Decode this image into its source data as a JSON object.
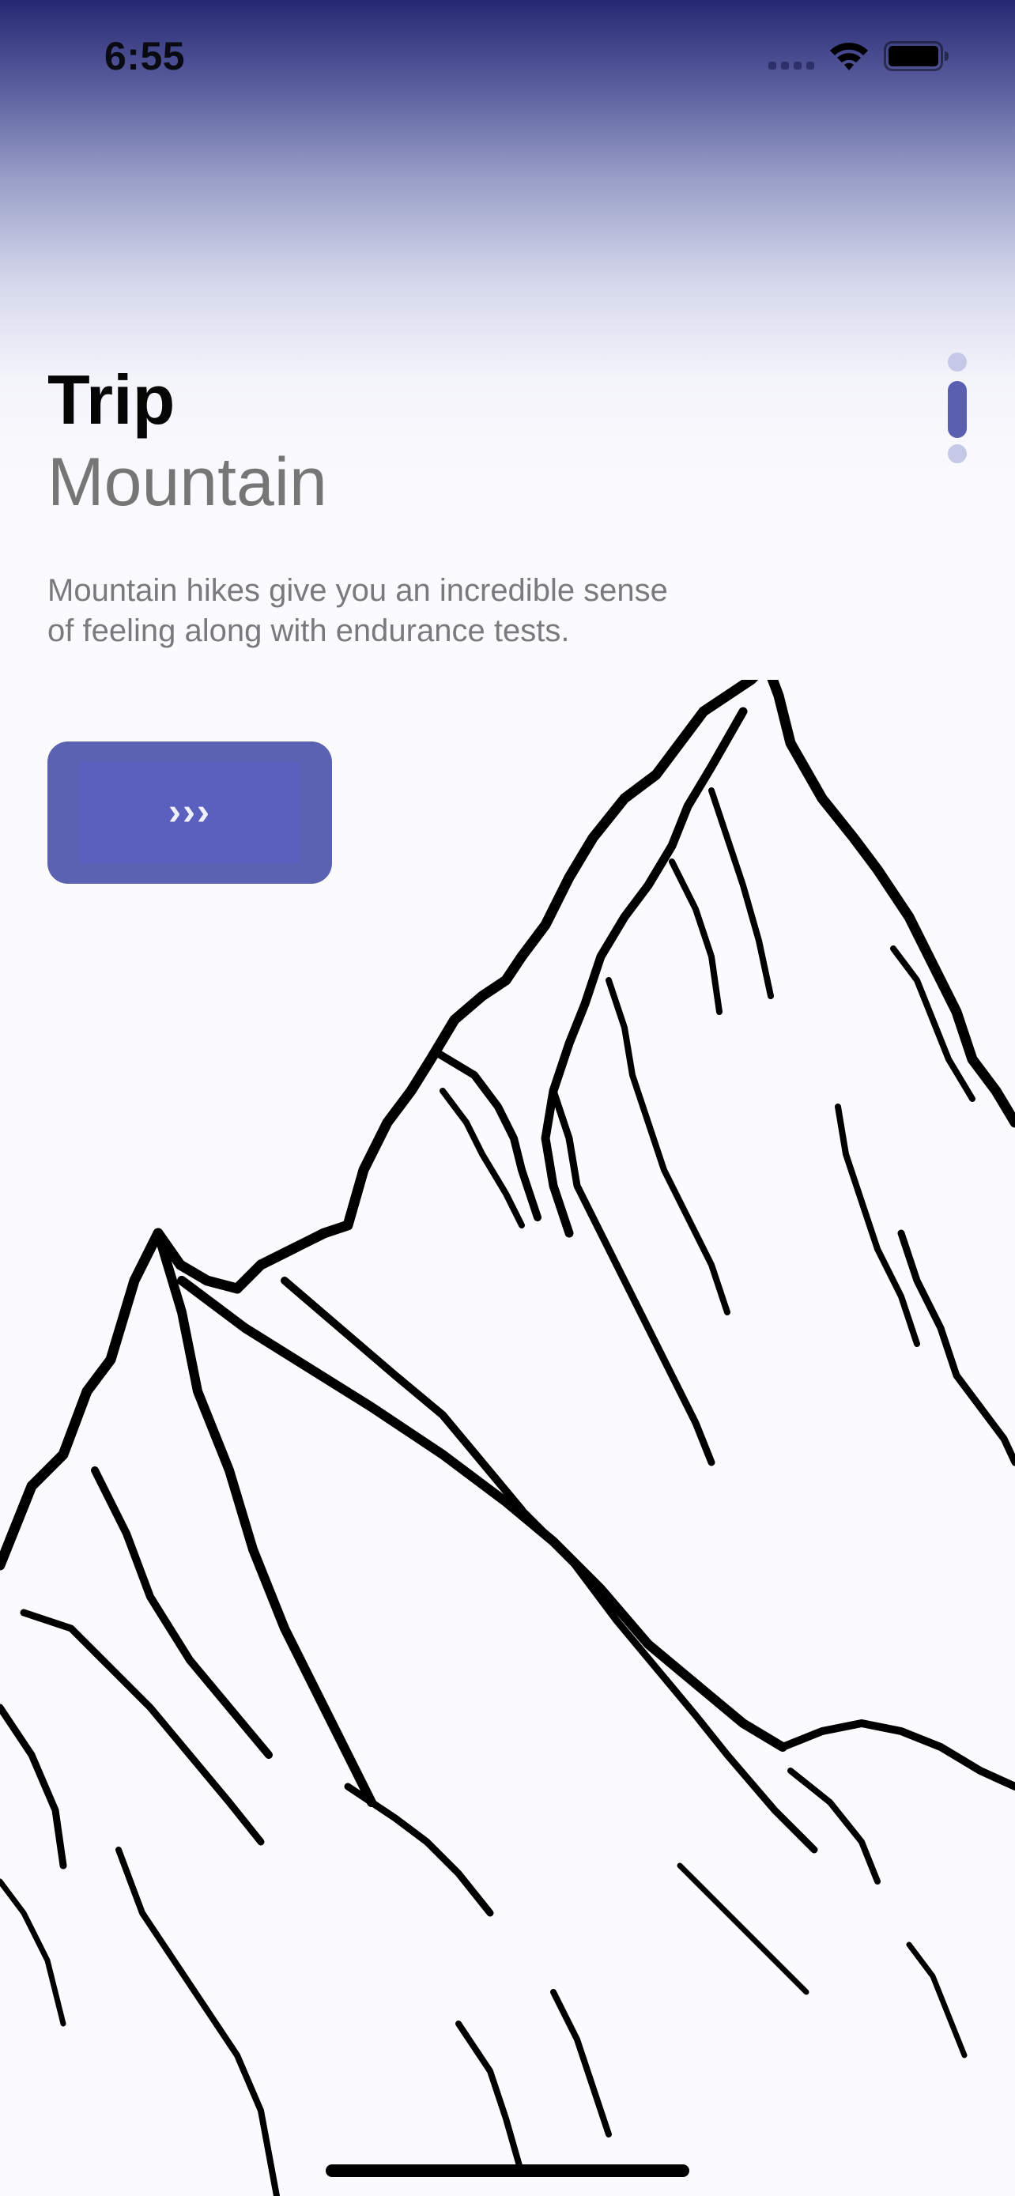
{
  "status_bar": {
    "time": "6:55"
  },
  "screen": {
    "title": "Trip",
    "subtitle": "Mountain",
    "description": "Mountain hikes give you an incredible sense of feeling along with endurance tests.",
    "next_button": {
      "label": "›››",
      "icon": "chevron-arrows-icon"
    }
  },
  "page_indicator": {
    "count": 3,
    "active_index": 1
  },
  "colors": {
    "accent": "#5c62b2",
    "header_gradient_top": "#262872",
    "background": "#fbfbfe",
    "title": "#050505",
    "subtitle": "#767676",
    "description": "#7a7a7e"
  },
  "icons": [
    "signal-icon",
    "wifi-icon",
    "battery-icon",
    "chevron-arrows-icon"
  ]
}
